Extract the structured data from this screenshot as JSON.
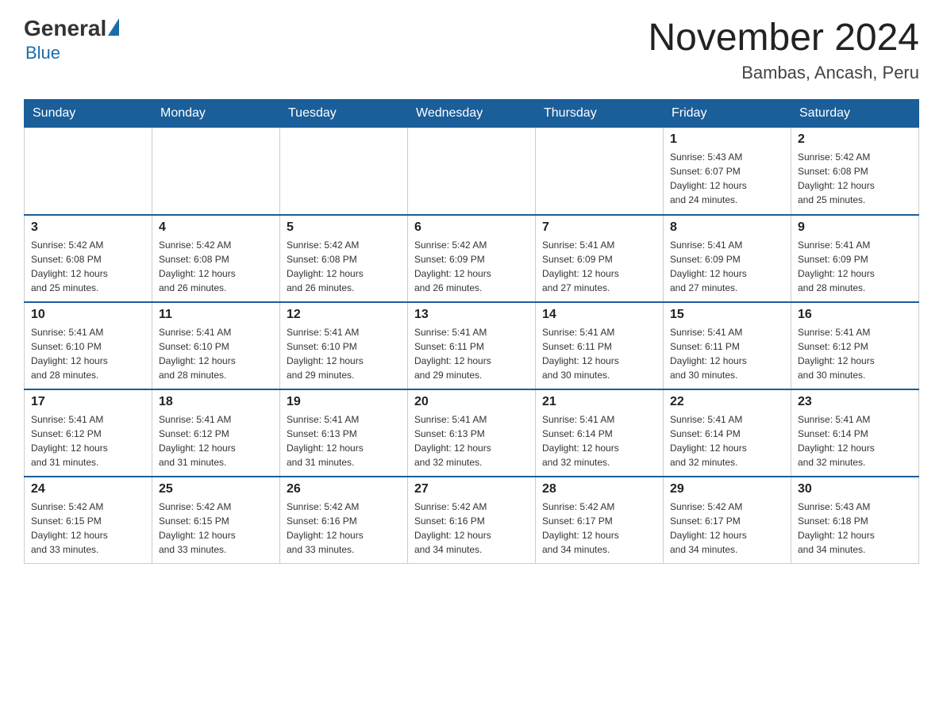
{
  "header": {
    "logo_general": "General",
    "logo_blue": "Blue",
    "month_title": "November 2024",
    "location": "Bambas, Ancash, Peru"
  },
  "weekdays": [
    "Sunday",
    "Monday",
    "Tuesday",
    "Wednesday",
    "Thursday",
    "Friday",
    "Saturday"
  ],
  "weeks": [
    [
      {
        "day": "",
        "info": ""
      },
      {
        "day": "",
        "info": ""
      },
      {
        "day": "",
        "info": ""
      },
      {
        "day": "",
        "info": ""
      },
      {
        "day": "",
        "info": ""
      },
      {
        "day": "1",
        "info": "Sunrise: 5:43 AM\nSunset: 6:07 PM\nDaylight: 12 hours\nand 24 minutes."
      },
      {
        "day": "2",
        "info": "Sunrise: 5:42 AM\nSunset: 6:08 PM\nDaylight: 12 hours\nand 25 minutes."
      }
    ],
    [
      {
        "day": "3",
        "info": "Sunrise: 5:42 AM\nSunset: 6:08 PM\nDaylight: 12 hours\nand 25 minutes."
      },
      {
        "day": "4",
        "info": "Sunrise: 5:42 AM\nSunset: 6:08 PM\nDaylight: 12 hours\nand 26 minutes."
      },
      {
        "day": "5",
        "info": "Sunrise: 5:42 AM\nSunset: 6:08 PM\nDaylight: 12 hours\nand 26 minutes."
      },
      {
        "day": "6",
        "info": "Sunrise: 5:42 AM\nSunset: 6:09 PM\nDaylight: 12 hours\nand 26 minutes."
      },
      {
        "day": "7",
        "info": "Sunrise: 5:41 AM\nSunset: 6:09 PM\nDaylight: 12 hours\nand 27 minutes."
      },
      {
        "day": "8",
        "info": "Sunrise: 5:41 AM\nSunset: 6:09 PM\nDaylight: 12 hours\nand 27 minutes."
      },
      {
        "day": "9",
        "info": "Sunrise: 5:41 AM\nSunset: 6:09 PM\nDaylight: 12 hours\nand 28 minutes."
      }
    ],
    [
      {
        "day": "10",
        "info": "Sunrise: 5:41 AM\nSunset: 6:10 PM\nDaylight: 12 hours\nand 28 minutes."
      },
      {
        "day": "11",
        "info": "Sunrise: 5:41 AM\nSunset: 6:10 PM\nDaylight: 12 hours\nand 28 minutes."
      },
      {
        "day": "12",
        "info": "Sunrise: 5:41 AM\nSunset: 6:10 PM\nDaylight: 12 hours\nand 29 minutes."
      },
      {
        "day": "13",
        "info": "Sunrise: 5:41 AM\nSunset: 6:11 PM\nDaylight: 12 hours\nand 29 minutes."
      },
      {
        "day": "14",
        "info": "Sunrise: 5:41 AM\nSunset: 6:11 PM\nDaylight: 12 hours\nand 30 minutes."
      },
      {
        "day": "15",
        "info": "Sunrise: 5:41 AM\nSunset: 6:11 PM\nDaylight: 12 hours\nand 30 minutes."
      },
      {
        "day": "16",
        "info": "Sunrise: 5:41 AM\nSunset: 6:12 PM\nDaylight: 12 hours\nand 30 minutes."
      }
    ],
    [
      {
        "day": "17",
        "info": "Sunrise: 5:41 AM\nSunset: 6:12 PM\nDaylight: 12 hours\nand 31 minutes."
      },
      {
        "day": "18",
        "info": "Sunrise: 5:41 AM\nSunset: 6:12 PM\nDaylight: 12 hours\nand 31 minutes."
      },
      {
        "day": "19",
        "info": "Sunrise: 5:41 AM\nSunset: 6:13 PM\nDaylight: 12 hours\nand 31 minutes."
      },
      {
        "day": "20",
        "info": "Sunrise: 5:41 AM\nSunset: 6:13 PM\nDaylight: 12 hours\nand 32 minutes."
      },
      {
        "day": "21",
        "info": "Sunrise: 5:41 AM\nSunset: 6:14 PM\nDaylight: 12 hours\nand 32 minutes."
      },
      {
        "day": "22",
        "info": "Sunrise: 5:41 AM\nSunset: 6:14 PM\nDaylight: 12 hours\nand 32 minutes."
      },
      {
        "day": "23",
        "info": "Sunrise: 5:41 AM\nSunset: 6:14 PM\nDaylight: 12 hours\nand 32 minutes."
      }
    ],
    [
      {
        "day": "24",
        "info": "Sunrise: 5:42 AM\nSunset: 6:15 PM\nDaylight: 12 hours\nand 33 minutes."
      },
      {
        "day": "25",
        "info": "Sunrise: 5:42 AM\nSunset: 6:15 PM\nDaylight: 12 hours\nand 33 minutes."
      },
      {
        "day": "26",
        "info": "Sunrise: 5:42 AM\nSunset: 6:16 PM\nDaylight: 12 hours\nand 33 minutes."
      },
      {
        "day": "27",
        "info": "Sunrise: 5:42 AM\nSunset: 6:16 PM\nDaylight: 12 hours\nand 34 minutes."
      },
      {
        "day": "28",
        "info": "Sunrise: 5:42 AM\nSunset: 6:17 PM\nDaylight: 12 hours\nand 34 minutes."
      },
      {
        "day": "29",
        "info": "Sunrise: 5:42 AM\nSunset: 6:17 PM\nDaylight: 12 hours\nand 34 minutes."
      },
      {
        "day": "30",
        "info": "Sunrise: 5:43 AM\nSunset: 6:18 PM\nDaylight: 12 hours\nand 34 minutes."
      }
    ]
  ]
}
